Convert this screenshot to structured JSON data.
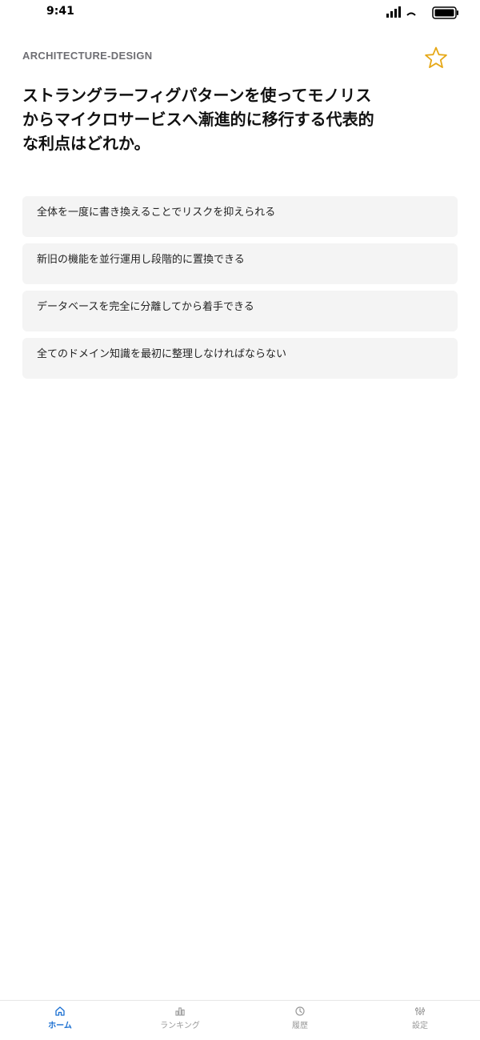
{
  "status_bar": {
    "time": "9:41"
  },
  "header": {
    "category": "ARCHITECTURE-DESIGN"
  },
  "question": {
    "text": "ストラングラーフィグパターンを使ってモノリスからマイクロサービスへ漸進的に移行する代表的な利点はどれか。"
  },
  "options": [
    {
      "text": "全体を一度に書き換えることでリスクを抑えられる"
    },
    {
      "text": "新旧の機能を並行運用し段階的に置換できる"
    },
    {
      "text": "データベースを完全に分離してから着手できる"
    },
    {
      "text": "全てのドメイン知識を最初に整理しなければならない"
    }
  ],
  "tab_bar": {
    "tabs": [
      {
        "label": "ホーム",
        "icon": "home-icon",
        "active": true
      },
      {
        "label": "ランキング",
        "icon": "ranking-icon",
        "active": false
      },
      {
        "label": "履歴",
        "icon": "clock-icon",
        "active": false
      },
      {
        "label": "設定",
        "icon": "settings-icon",
        "active": false
      }
    ]
  },
  "colors": {
    "accent": "#1a6fd1",
    "star": "#e6a817",
    "option_bg": "#f4f4f4"
  }
}
